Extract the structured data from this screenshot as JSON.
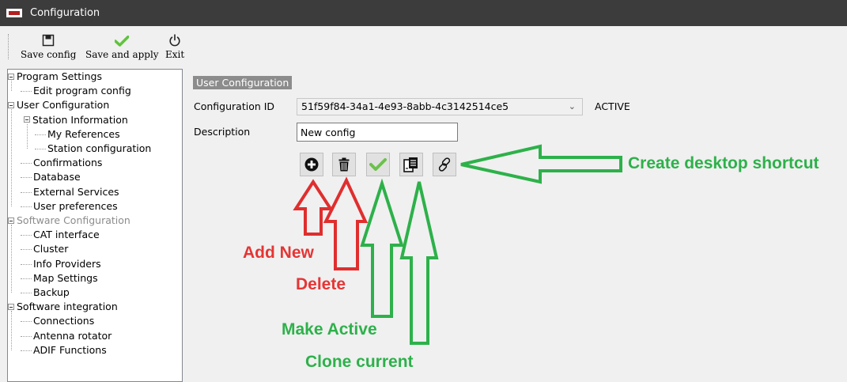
{
  "window": {
    "title": "Configuration",
    "logo_icon": "app-logo-icon"
  },
  "toolbar": {
    "save_config": {
      "label": "Save config",
      "icon": "floppy-disk-icon"
    },
    "save_apply": {
      "label": "Save and apply",
      "icon": "checkmark-icon"
    },
    "exit": {
      "label": "Exit",
      "icon": "power-icon"
    }
  },
  "tree": {
    "items": [
      {
        "label": "Program Settings",
        "level": 0,
        "expander": true,
        "disabled": false
      },
      {
        "label": "Edit program config",
        "level": 1,
        "expander": false,
        "disabled": false
      },
      {
        "label": "User Configuration",
        "level": 0,
        "expander": true,
        "disabled": false
      },
      {
        "label": "Station Information",
        "level": 1,
        "expander": true,
        "disabled": false
      },
      {
        "label": "My References",
        "level": 2,
        "expander": false,
        "disabled": false
      },
      {
        "label": "Station configuration",
        "level": 2,
        "expander": false,
        "disabled": false
      },
      {
        "label": "Confirmations",
        "level": 1,
        "expander": false,
        "disabled": false
      },
      {
        "label": "Database",
        "level": 1,
        "expander": false,
        "disabled": false
      },
      {
        "label": "External Services",
        "level": 1,
        "expander": false,
        "disabled": false
      },
      {
        "label": "User preferences",
        "level": 1,
        "expander": false,
        "disabled": false
      },
      {
        "label": "Software Configuration",
        "level": 0,
        "expander": true,
        "disabled": true
      },
      {
        "label": "CAT interface",
        "level": 1,
        "expander": false,
        "disabled": false
      },
      {
        "label": "Cluster",
        "level": 1,
        "expander": false,
        "disabled": false
      },
      {
        "label": "Info Providers",
        "level": 1,
        "expander": false,
        "disabled": false
      },
      {
        "label": "Map Settings",
        "level": 1,
        "expander": false,
        "disabled": false
      },
      {
        "label": "Backup",
        "level": 1,
        "expander": false,
        "disabled": false
      },
      {
        "label": "Software integration",
        "level": 0,
        "expander": true,
        "disabled": false
      },
      {
        "label": "Connections",
        "level": 1,
        "expander": false,
        "disabled": false
      },
      {
        "label": "Antenna rotator",
        "level": 1,
        "expander": false,
        "disabled": false
      },
      {
        "label": "ADIF Functions",
        "level": 1,
        "expander": false,
        "disabled": false
      }
    ]
  },
  "main": {
    "panel_title": "User Configuration",
    "config_id_label": "Configuration ID",
    "config_id_value": "51f59f84-34a1-4e93-8abb-4c3142514ce5",
    "status": "ACTIVE",
    "description_label": "Description",
    "description_value": "New config",
    "buttons": [
      {
        "name": "add-new-button",
        "icon": "plus-circle-icon"
      },
      {
        "name": "delete-button",
        "icon": "trash-icon"
      },
      {
        "name": "make-active-button",
        "icon": "checkmark-icon"
      },
      {
        "name": "clone-button",
        "icon": "copy-icon"
      },
      {
        "name": "shortcut-button",
        "icon": "link-icon"
      }
    ]
  },
  "annotations": {
    "add_new": "Add New",
    "delete": "Delete",
    "make_active": "Make Active",
    "clone_current": "Clone current",
    "create_shortcut": "Create desktop shortcut"
  },
  "colors": {
    "titlebar": "#3c3c3c",
    "annotation_red": "#e53535",
    "annotation_green": "#2db14a",
    "panel_title_bg": "#8c8c8c"
  }
}
